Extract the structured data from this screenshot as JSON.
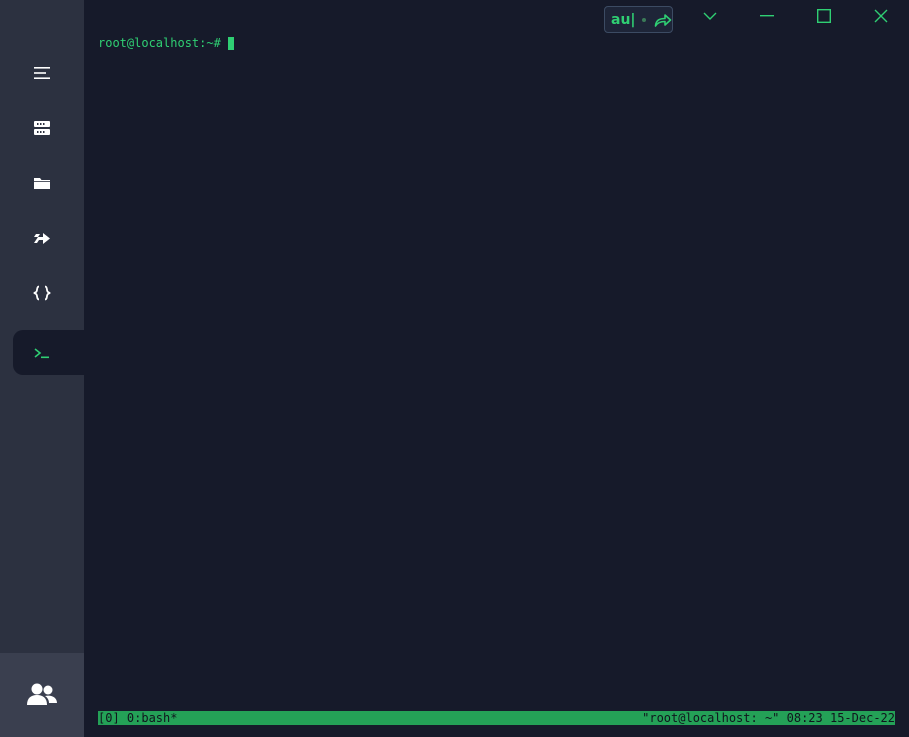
{
  "sidebar": {
    "items": [
      {
        "icon": "menu-icon",
        "label": ""
      },
      {
        "icon": "hosts-icon",
        "label": ""
      },
      {
        "icon": "folder-icon",
        "label": ""
      },
      {
        "icon": "port-forward-icon",
        "label": ""
      },
      {
        "icon": "snippets-icon",
        "label": ""
      },
      {
        "icon": "terminal-icon",
        "label": "",
        "active": true
      }
    ],
    "bottom_icon": "team-icon"
  },
  "titlebar": {
    "input_indicator": "au|",
    "controls": [
      "chevron-down-icon",
      "minimize-icon",
      "maximize-icon",
      "close-icon"
    ]
  },
  "terminal": {
    "prompt": "root@localhost:~#",
    "accent_color": "#2fcf73"
  },
  "statusbar": {
    "left": "[0] 0:bash*",
    "right": "\"root@localhost: ~\" 08:23 15-Dec-22",
    "background": "#24a157"
  }
}
